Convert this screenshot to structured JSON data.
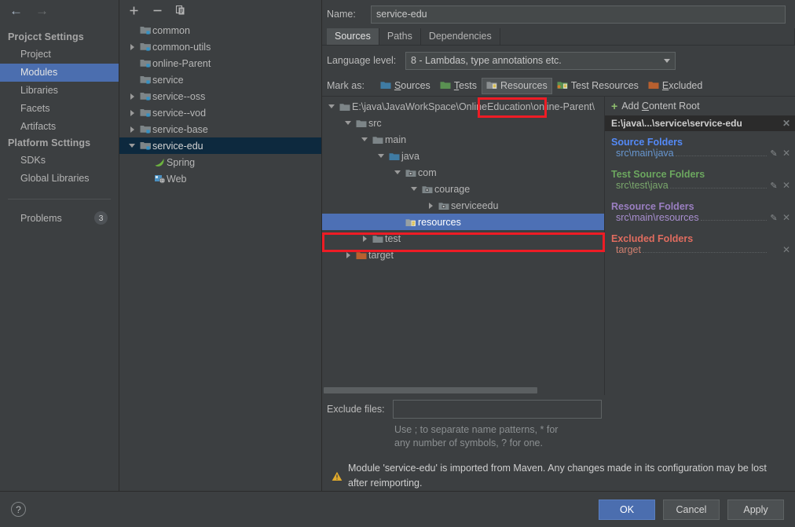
{
  "nav": {
    "back_icon": "arrow-left-icon",
    "forward_icon": "arrow-right-icon",
    "project_settings_header": "Projcct Settings",
    "project_items": [
      {
        "label": "Project",
        "selected": false
      },
      {
        "label": "Modules",
        "selected": true
      },
      {
        "label": "Libraries",
        "selected": false
      },
      {
        "label": "Facets",
        "selected": false
      },
      {
        "label": "Artifacts",
        "selected": false
      }
    ],
    "platform_settings_header": "Platform Scttings",
    "platform_items": [
      {
        "label": "SDKs",
        "selected": false
      },
      {
        "label": "Global Libraries",
        "selected": false
      }
    ],
    "problems_label": "Problems",
    "problems_count": "3"
  },
  "modules_panel": {
    "toolbar": [
      {
        "name": "add-module-button",
        "glyph": "+"
      },
      {
        "name": "remove-module-button",
        "glyph": "−"
      },
      {
        "name": "copy-module-button",
        "glyph": "copy-icon"
      }
    ],
    "items": [
      {
        "label": "common",
        "indent": 1,
        "twisty": "none",
        "icon": "module-folder-icon",
        "selected": false
      },
      {
        "label": "common-utils",
        "indent": 1,
        "twisty": "right",
        "icon": "module-folder-icon",
        "selected": false
      },
      {
        "label": "online-Parent",
        "indent": 1,
        "twisty": "none",
        "icon": "module-folder-icon",
        "selected": false
      },
      {
        "label": "service",
        "indent": 1,
        "twisty": "none",
        "icon": "module-folder-icon",
        "selected": false
      },
      {
        "label": "service--oss",
        "indent": 1,
        "twisty": "right",
        "icon": "module-folder-icon",
        "selected": false
      },
      {
        "label": "service--vod",
        "indent": 1,
        "twisty": "right",
        "icon": "module-folder-icon",
        "selected": false
      },
      {
        "label": "service-base",
        "indent": 1,
        "twisty": "right",
        "icon": "module-folder-icon",
        "selected": false
      },
      {
        "label": "service-edu",
        "indent": 1,
        "twisty": "down",
        "icon": "module-folder-icon",
        "selected": true
      },
      {
        "label": "Spring",
        "indent": 2,
        "twisty": "none",
        "icon": "spring-leaf-icon",
        "selected": false
      },
      {
        "label": "Web",
        "indent": 2,
        "twisty": "none",
        "icon": "web-globe-icon",
        "selected": false
      }
    ]
  },
  "detail": {
    "name_label": "Name:",
    "name_value": "service-edu",
    "tabs": [
      {
        "label": "Sources",
        "active": true
      },
      {
        "label": "Paths",
        "active": false
      },
      {
        "label": "Dependencies",
        "active": false
      }
    ],
    "language_level_label": "Language level:",
    "language_level_value": "8 - Lambdas, type annotations etc.",
    "mark_as_label": "Mark as:",
    "mark_as_buttons": [
      {
        "label": "Sources",
        "mnemonic": "S",
        "rest": "ources",
        "icon": "sources-folder-icon",
        "color": "#3f7ba3",
        "pressed": false
      },
      {
        "label": "Tests",
        "mnemonic": "T",
        "rest": "ests",
        "icon": "tests-folder-icon",
        "color": "#5a9152",
        "pressed": false
      },
      {
        "label": "Resources",
        "mnemonic": "",
        "rest": "Resources",
        "icon": "resources-folder-icon",
        "color": "#8b8f91",
        "pressed": true
      },
      {
        "label": "Test Resources",
        "mnemonic": "",
        "rest": "Test Resources",
        "icon": "test-resources-folder-icon",
        "color": "#5a9152",
        "pressed": false
      },
      {
        "label": "Excluded",
        "mnemonic": "E",
        "rest": "xcluded",
        "icon": "excluded-folder-icon",
        "color": "#b8602f",
        "pressed": false
      }
    ],
    "tree": [
      {
        "label": "E:\\java\\JavaWorkSpace\\OnlineEducation\\online-Parent\\",
        "indent": 0,
        "twisty": "down",
        "icon": "folder-gray-icon",
        "selected": false
      },
      {
        "label": "src",
        "indent": 1,
        "twisty": "down",
        "icon": "folder-gray-icon",
        "selected": false
      },
      {
        "label": "main",
        "indent": 2,
        "twisty": "down",
        "icon": "folder-gray-icon",
        "selected": false
      },
      {
        "label": "java",
        "indent": 3,
        "twisty": "down",
        "icon": "folder-source-icon",
        "selected": false
      },
      {
        "label": "com",
        "indent": 4,
        "twisty": "down",
        "icon": "folder-package-icon",
        "selected": false
      },
      {
        "label": "courage",
        "indent": 5,
        "twisty": "down",
        "icon": "folder-package-icon",
        "selected": false
      },
      {
        "label": "serviceedu",
        "indent": 6,
        "twisty": "right",
        "icon": "folder-package-icon",
        "selected": false
      },
      {
        "label": "resources",
        "indent": 4,
        "twisty": "none",
        "icon": "folder-resources-icon",
        "selected": true
      },
      {
        "label": "test",
        "indent": 2,
        "twisty": "right",
        "icon": "folder-gray-icon",
        "selected": false
      },
      {
        "label": "target",
        "indent": 1,
        "twisty": "right",
        "icon": "folder-excluded-icon",
        "selected": false
      }
    ],
    "add_content_root_label": "Add Content Root",
    "add_content_root_mnemonic": "C",
    "content_root_path": "E:\\java\\...\\service\\service-edu",
    "folder_sections": [
      {
        "title": "Source Folders",
        "kind": "src",
        "folders": [
          {
            "path": "src\\main\\java",
            "has_edit": true,
            "has_close": true
          }
        ]
      },
      {
        "title": "Test Source Folders",
        "kind": "test",
        "folders": [
          {
            "path": "src\\test\\java",
            "has_edit": true,
            "has_close": true
          }
        ]
      },
      {
        "title": "Resource Folders",
        "kind": "res",
        "folders": [
          {
            "path": "src\\main\\resources",
            "has_edit": true,
            "has_close": true
          }
        ]
      },
      {
        "title": "Excluded Folders",
        "kind": "exc",
        "folders": [
          {
            "path": "target",
            "has_edit": false,
            "has_close": true
          }
        ]
      }
    ],
    "exclude_files_label": "Exclude files:",
    "exclude_files_value": "",
    "exclude_hint": "Use ; to separate name patterns, * for any number of symbols, ? for one.",
    "warning_text": "Module 'service-edu' is imported from Maven. Any changes made in its configuration may be lost after reimporting."
  },
  "bottom": {
    "help_glyph": "?",
    "buttons": [
      {
        "label": "OK",
        "primary": true
      },
      {
        "label": "Cancel",
        "primary": false
      },
      {
        "label": "Apply",
        "primary": false
      }
    ]
  },
  "colors": {
    "window_bg": "#3c3f41",
    "nav_selected": "#4b6eaf",
    "tree_selected": "#4d70b5",
    "module_selected": "#0d293e",
    "annotation_red": "#ee1c25",
    "source_blue": "#548af7",
    "test_green": "#6ca75f",
    "resource_purple": "#9b7fc2",
    "excluded_red": "#e06c5f"
  }
}
